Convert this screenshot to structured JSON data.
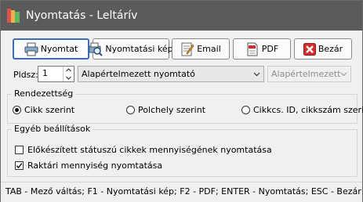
{
  "window": {
    "title": "Nyomtatás - Leltárív"
  },
  "toolbar": {
    "buttons": [
      {
        "label": "Nyomtat",
        "icon": "printer-icon"
      },
      {
        "label": "Nyomtatási kép",
        "icon": "print-preview-icon"
      },
      {
        "label": "Email",
        "icon": "email-icon"
      },
      {
        "label": "PDF",
        "icon": "pdf-icon"
      },
      {
        "label": "Bezár",
        "icon": "close-icon"
      }
    ]
  },
  "print_options": {
    "copies_label": "Pldsz:",
    "copies_value": "1",
    "printer_value": "Alapértelmezett nyomtató",
    "tray_value": "Alapértelmezett"
  },
  "sort_group": {
    "title": "Rendezettség",
    "options": [
      {
        "label": "Cikk szerint",
        "selected": true
      },
      {
        "label": "Polchely szerint",
        "selected": false
      },
      {
        "label": "Cikkcs. ID, cikkszám szerint",
        "selected": false
      }
    ]
  },
  "other_group": {
    "title": "Egyéb beállítások",
    "checkboxes": [
      {
        "label": "Előkészített státuszú cikkek mennyiségének nyomtatása",
        "checked": false
      },
      {
        "label": "Raktári mennyiség nyomtatása",
        "checked": true
      }
    ]
  },
  "status_bar": {
    "text": "TAB - Mező váltás; F1 - Nyomtatási kép; F2 - PDF; ENTER - Nyomtatás; ESC - Bezár"
  },
  "colors": {
    "titlebar": "#5b5b5b",
    "focus_border": "#3e6db5",
    "close_red": "#d62c2c"
  }
}
